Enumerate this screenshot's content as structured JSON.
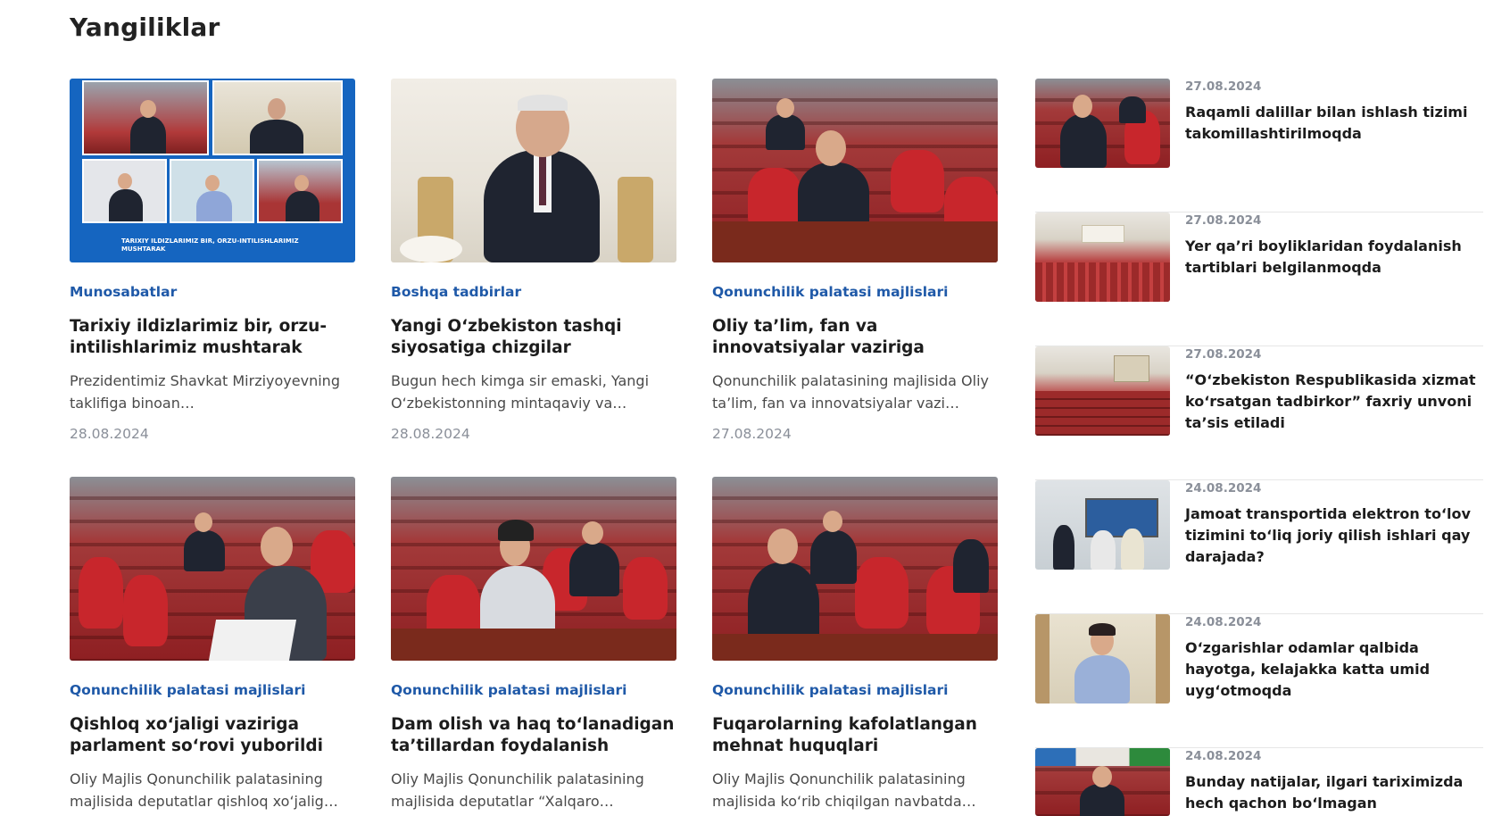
{
  "section": {
    "title": "Yangiliklar"
  },
  "cards": [
    {
      "category": "Munosabatlar",
      "title": "Tarixiy ildizlarimiz bir, orzu-intilishlarimiz mushtarak",
      "excerpt": "Prezidentimiz Shavkat Mirziyoyevning taklifiga binoan…",
      "date": "28.08.2024",
      "image_banner": "TARIXIY ILDIZLARIMIZ BIR, ORZU-INTILISHLARIMIZ MUSHTARAK"
    },
    {
      "category": "Boshqa tadbirlar",
      "title": "Yangi O‘zbekiston tashqi siyosatiga chizgilar",
      "excerpt": "Bugun hech kimga sir emaski, Yangi O‘zbekistonning mintaqaviy va…",
      "date": "28.08.2024"
    },
    {
      "category": "Qonunchilik palatasi majlislari",
      "title": "Oliy ta’lim, fan va innovatsiyalar vaziriga parlament so‘rovi…",
      "excerpt": "Qonunchilik palatasining majlisida Oliy ta’lim, fan va innovatsiyalar vazi…",
      "date": "27.08.2024"
    },
    {
      "category": "Qonunchilik palatasi majlislari",
      "title": "Qishloq xo‘jaligi vaziriga parlament so‘rovi yuborildi",
      "excerpt": "Oliy Majlis Qonunchilik palatasining majlisida deputatlar qishloq xo‘jalig…",
      "date": ""
    },
    {
      "category": "Qonunchilik palatasi majlislari",
      "title": "Dam olish va haq to‘lanadigan ta’tillardan foydalanish huquqlar…",
      "excerpt": "Oliy Majlis Qonunchilik palatasining majlisida deputatlar “Xalqaro…",
      "date": ""
    },
    {
      "category": "Qonunchilik palatasi majlislari",
      "title": "Fuqarolarning kafolatlangan mehnat huquqlari ta’minlanadi",
      "excerpt": "Oliy Majlis Qonunchilik palatasining majlisida ko‘rib chiqilgan navbatda…",
      "date": ""
    }
  ],
  "side_news": [
    {
      "date": "27.08.2024",
      "title": "Raqamli dalillar bilan ishlash tizimi takomillashtirilmoqda"
    },
    {
      "date": "27.08.2024",
      "title": "Yer qa’ri boyliklaridan foydalanish tartiblari belgilanmoqda"
    },
    {
      "date": "27.08.2024",
      "title": "“O‘zbekiston Respublikasida xizmat ko‘rsatgan tadbirkor” faxriy unvoni ta’sis etiladi"
    },
    {
      "date": "24.08.2024",
      "title": "Jamoat transportida elektron to‘lov tizimini to‘liq joriy qilish ishlari qay darajada?"
    },
    {
      "date": "24.08.2024",
      "title": "O‘zgarishlar odamlar qalbida hayotga, kelajakka katta umid uyg‘otmoqda"
    },
    {
      "date": "24.08.2024",
      "title": "Bunday natijalar, ilgari tariximizda hech qachon bo‘lmagan"
    }
  ]
}
